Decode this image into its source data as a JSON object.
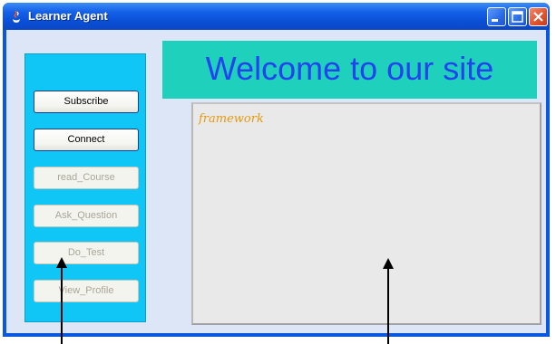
{
  "window": {
    "title": "Learner Agent",
    "controls": [
      "minimize",
      "maximize",
      "close"
    ]
  },
  "sidebar": {
    "buttons": [
      {
        "label": "Subscribe",
        "enabled": true
      },
      {
        "label": "Connect",
        "enabled": true
      },
      {
        "label": "read_Course",
        "enabled": false
      },
      {
        "label": "Ask_Question",
        "enabled": false
      },
      {
        "label": "Do_Test",
        "enabled": false
      },
      {
        "label": "View_Profile",
        "enabled": false
      }
    ]
  },
  "banner": {
    "text": "Welcome to our site"
  },
  "panel": {
    "label": "framework"
  },
  "colors": {
    "titlebar": "#0a58de",
    "sidebar": "#10c6f6",
    "banner": "#1fd1bd",
    "banner_text": "#2244ee",
    "framework_text": "#e69a12"
  }
}
